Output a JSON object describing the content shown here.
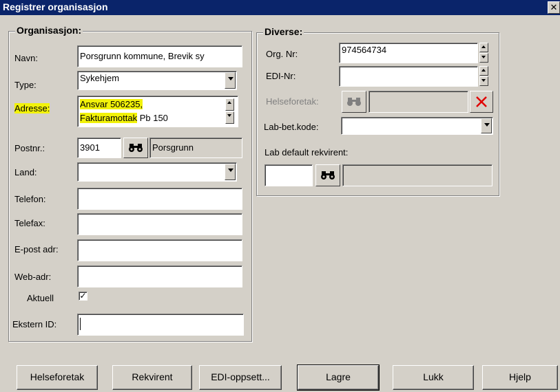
{
  "window": {
    "title": "Registrer organisasjon",
    "close_glyph": "✕"
  },
  "organisasjon": {
    "legend": "Organisasjon:",
    "navn_label": "Navn:",
    "navn_value": "Porsgrunn kommune, Brevik sy",
    "type_label": "Type:",
    "type_value": "Sykehjem",
    "adresse_label": "Adresse:",
    "adresse_line1": "Ansvar 506235,",
    "adresse_line2a": "Fakturamottak",
    "adresse_line2b": " Pb 150",
    "postnr_label": "Postnr.:",
    "postnr_value": "3901",
    "poststed_value": "Porsgrunn",
    "land_label": "Land:",
    "land_value": "",
    "telefon_label": "Telefon:",
    "telefon_value": "",
    "telefax_label": "Telefax:",
    "telefax_value": "",
    "epost_label": "E-post adr:",
    "epost_value": "",
    "web_label": "Web-adr:",
    "web_value": "",
    "aktuell_label": "Aktuell",
    "aktuell_checked": "✓",
    "ekstern_label": "Ekstern ID:",
    "ekstern_value": ""
  },
  "diverse": {
    "legend": "Diverse:",
    "orgnr_label": "Org. Nr:",
    "orgnr_value": "974564734",
    "edinr_label": "EDI-Nr:",
    "edinr_value": "",
    "helseforetak_label": "Helseforetak:",
    "helseforetak_value": "",
    "labbet_label": "Lab-bet.kode:",
    "labbet_value": "",
    "labdef_label": "Lab default rekvirent:",
    "labdef_code": "",
    "labdef_name": ""
  },
  "icons": {
    "search": "binoculars-icon",
    "clear": "red-x-icon"
  },
  "colors": {
    "highlight": "#f2f20a",
    "titlebar": "#0a246a",
    "clear_x": "#e00000"
  },
  "buttons": {
    "helseforetak": "Helseforetak",
    "rekvirent": "Rekvirent",
    "edi_oppsett": "EDI-oppsett...",
    "lagre": "Lagre",
    "lukk": "Lukk",
    "hjelp": "Hjelp"
  }
}
